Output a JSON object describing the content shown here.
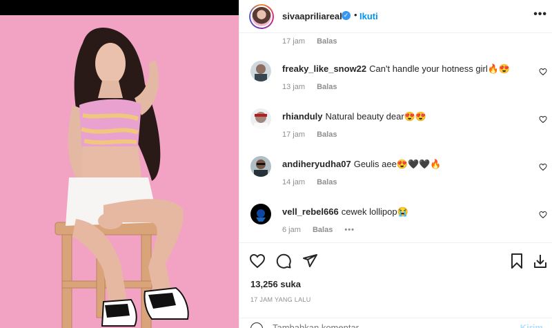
{
  "post": {
    "username": "sivaapriliareal",
    "verified_icon": "verified-badge-icon",
    "separator": "•",
    "follow_label": "Ikuti",
    "more_label": "•••"
  },
  "comments": {
    "first_meta": {
      "time": "17 jam",
      "reply": "Balas"
    },
    "items": [
      {
        "username": "freaky_like_snow22",
        "text": "Can't handle your hotness girl🔥😍",
        "time": "13 jam",
        "reply": "Balas"
      },
      {
        "username": "rhianduly",
        "text": "Natural beauty dear😍😍",
        "time": "17 jam",
        "reply": "Balas"
      },
      {
        "username": "andiheryudha07",
        "text": "Geulis aee😍🖤🖤🔥",
        "time": "14 jam",
        "reply": "Balas"
      },
      {
        "username": "vell_rebel666",
        "text": "cewek lollipop😭",
        "time": "6 jam",
        "reply": "Balas",
        "more": "•••"
      }
    ]
  },
  "actions": {
    "likes": "13,256 suka",
    "time_ago": "17 JAM YANG LALU",
    "comment_placeholder": "Tambahkan komentar...",
    "post_label": "Kirim"
  },
  "colors": {
    "accent": "#0095f6",
    "photo_bg": "#f2a3c4"
  }
}
